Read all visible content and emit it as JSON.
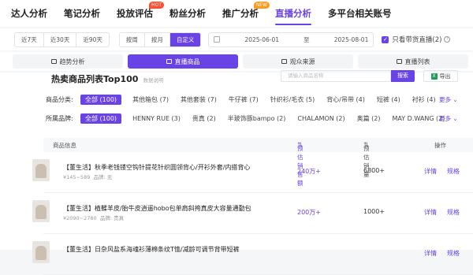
{
  "top_nav": [
    {
      "label": "达人分析"
    },
    {
      "label": "笔记分析"
    },
    {
      "label": "投放评估",
      "badge": "HOT"
    },
    {
      "label": "粉丝分析"
    },
    {
      "label": "推广分析",
      "badge": "NEW"
    },
    {
      "label": "直播分析",
      "active": true
    },
    {
      "label": "多平台相关账号"
    }
  ],
  "filters": {
    "quick_ranges": [
      "近7天",
      "近30天",
      "近90天"
    ],
    "granularity": [
      "按周",
      "按月",
      "自定义"
    ],
    "granularity_selected": "自定义",
    "date_start": "2025-06-01",
    "date_sep": "至",
    "date_end": "2025-08-01",
    "only_with_goods_label": "只看带货直播(2)",
    "only_with_goods_checked": true
  },
  "tabs": [
    {
      "label": "趋势分析"
    },
    {
      "label": "直播商品",
      "active": true
    },
    {
      "label": "观众来源"
    },
    {
      "label": "直播列表"
    }
  ],
  "section": {
    "title": "热卖商品列表Top100",
    "subtitle": "数据说明",
    "search_placeholder": "请输入商品名称",
    "search_button": "搜索",
    "export_button": "导出",
    "export_icon": "excel-icon"
  },
  "category_filter": {
    "label": "商品分类:",
    "chips": [
      "全部 (100)",
      "其他箱包 (7)",
      "其他套装 (7)",
      "牛仔裤 (7)",
      "针织衫/毛衣 (5)",
      "背心/吊带 (4)",
      "短裤 (4)",
      "衬衫 (4)"
    ],
    "more": "更多"
  },
  "brand_filter": {
    "label": "所属品牌:",
    "chips": [
      "全部 (100)",
      "HENNY RUE (3)",
      "贵真 (2)",
      "半玻饰豚bampo (2)",
      "CHALAMON (2)",
      "奥篇 (2)",
      "MAY D.WANG (2)"
    ],
    "more": "更多"
  },
  "table": {
    "headers": {
      "info": "商品信息",
      "sales": "预估销售额",
      "volume": "预估销量",
      "action": "操作"
    },
    "rows": [
      {
        "title": "【董生活】秋季老钱镂空钩针提花针织圆领背心/开衫外套/内搭背心",
        "price": "¥145~589",
        "brand": "品牌: 无",
        "sales": "240万+",
        "volume": "6800+",
        "actions": [
          "详情",
          "规格"
        ]
      },
      {
        "title": "【董生活】植鞣羊皮/胎牛皮逍遥hobo包单肩斜挎真皮大容量通勤包",
        "price": "¥2090~2780",
        "brand": "品牌: 贵真",
        "sales": "200万+",
        "volume": "1000+",
        "actions": [
          "详情",
          "规格"
        ]
      },
      {
        "title": "【董生活】日杂风盐系海魂衫薄棉条纹T恤/减龄可调节背带短裤",
        "price": "",
        "brand": "",
        "sales": "",
        "volume": "",
        "actions": [
          "详情",
          "规格"
        ]
      }
    ]
  },
  "colors": {
    "accent": "#6a43e6",
    "hot": "#ff4d2e",
    "new": "#ff9a1f"
  }
}
